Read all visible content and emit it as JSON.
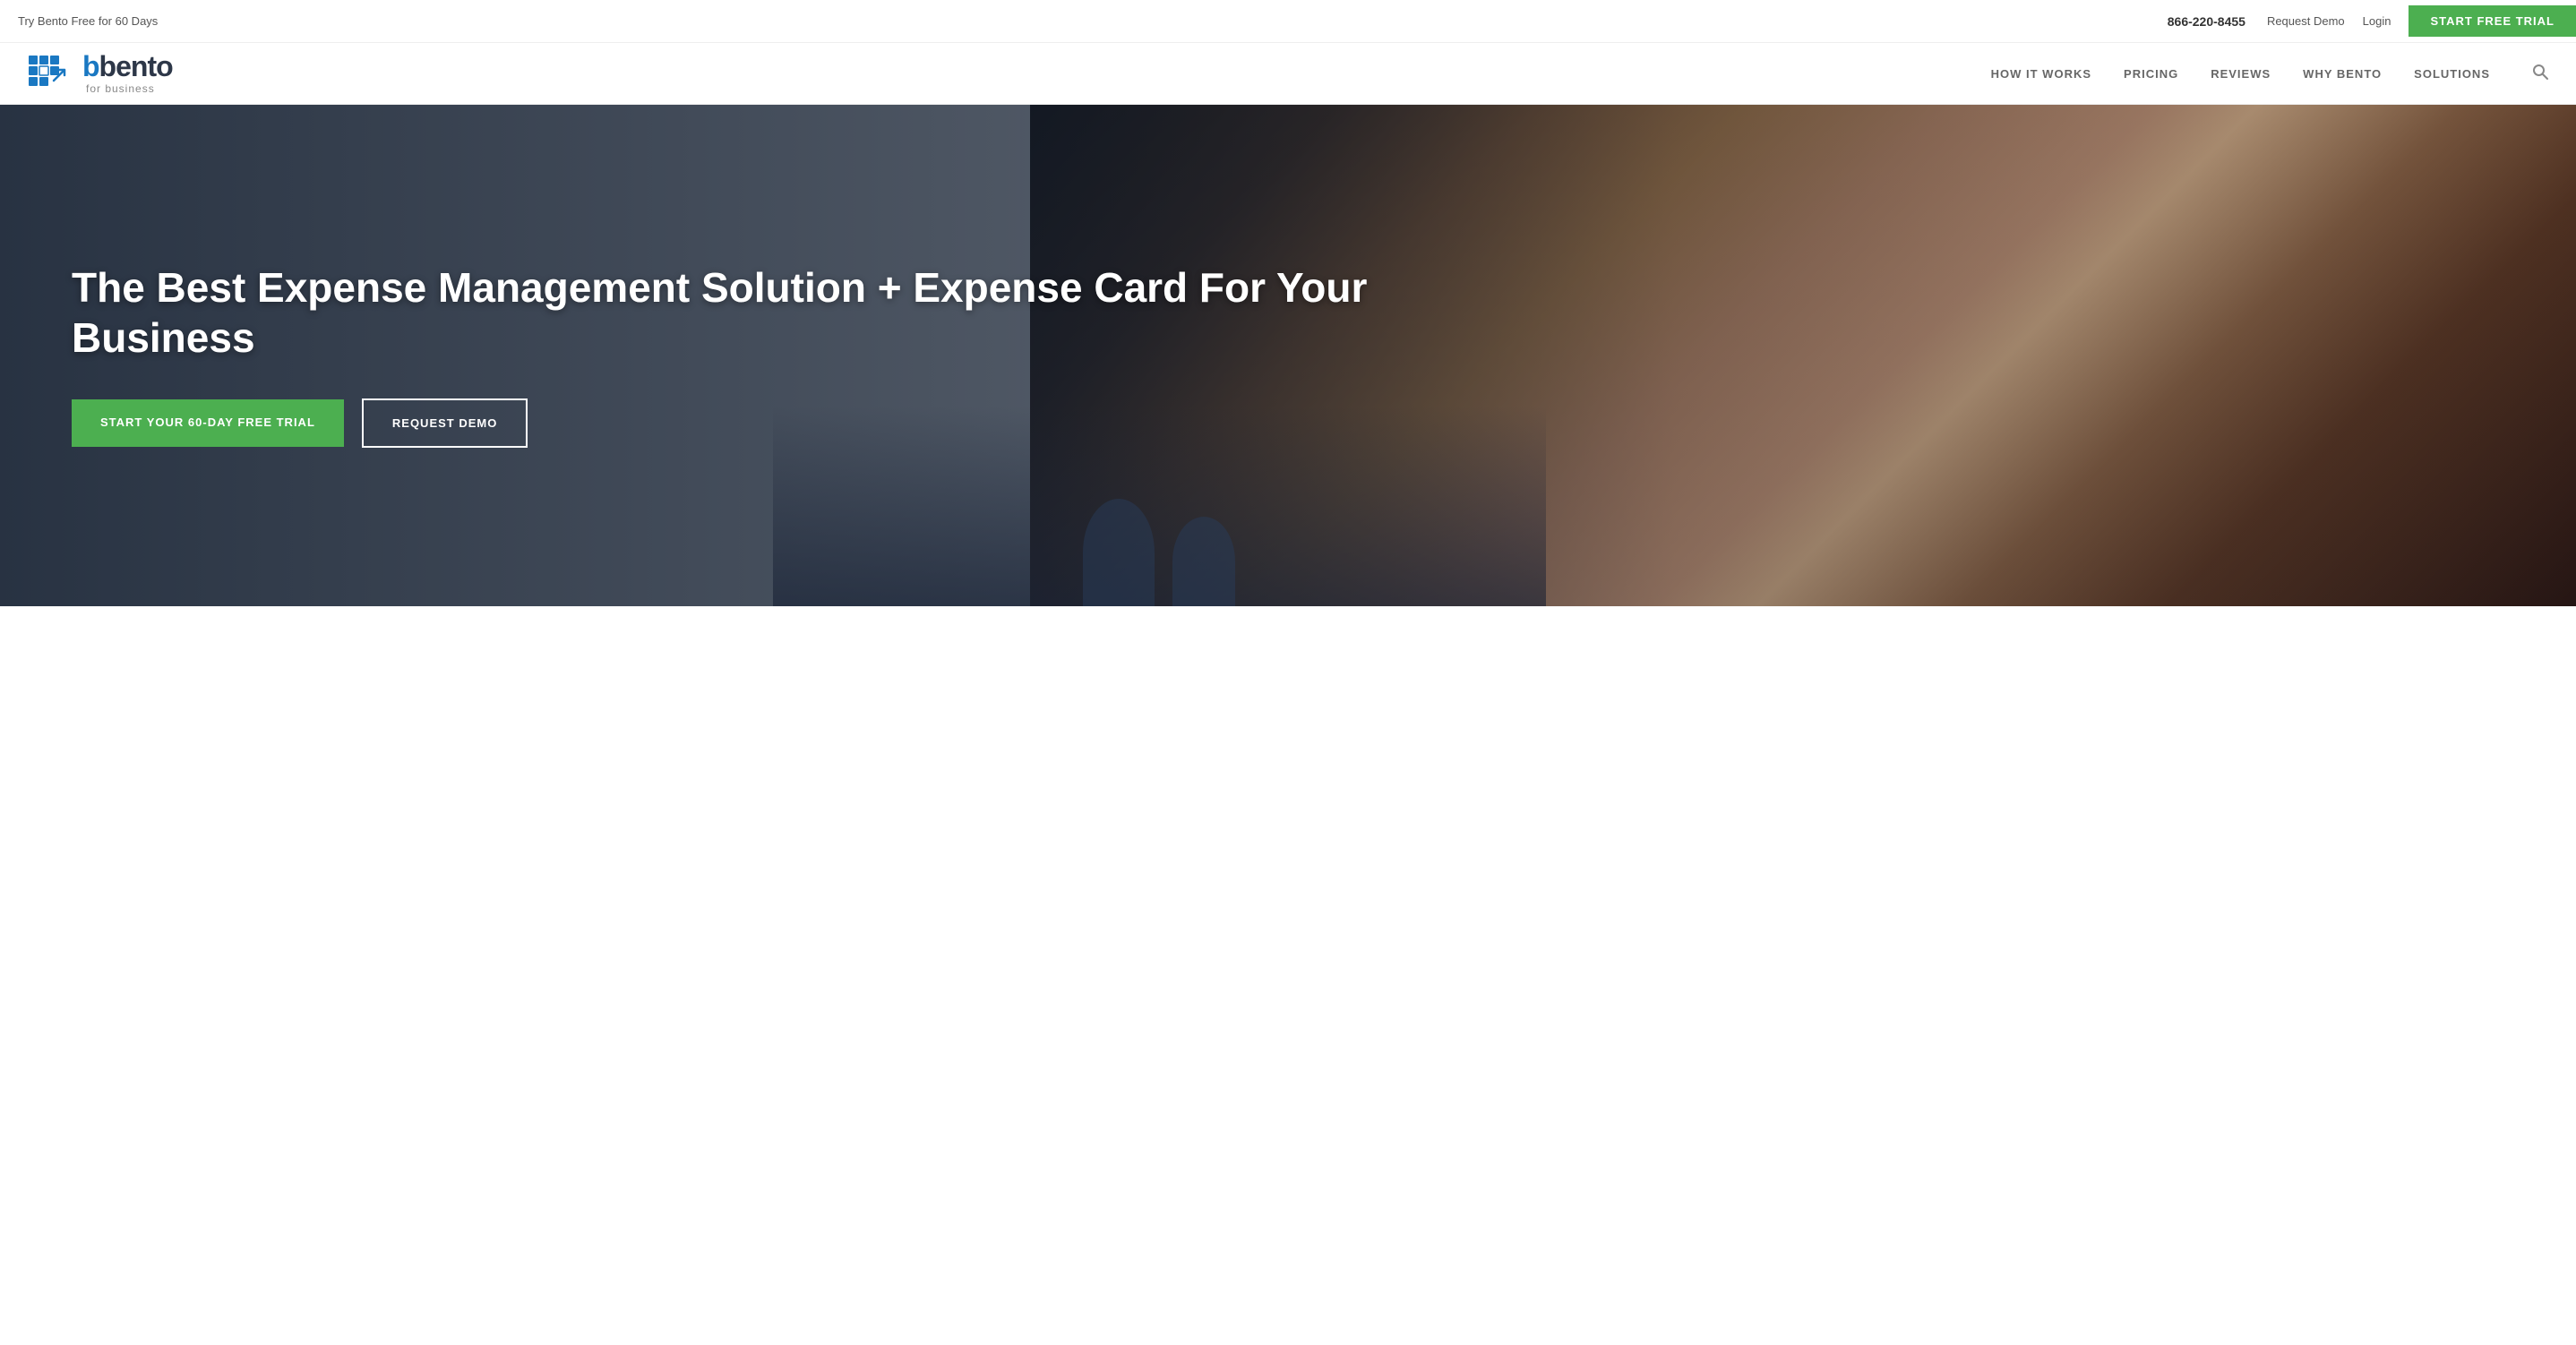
{
  "topbar": {
    "trial_text": "Try Bento Free for 60 Days",
    "phone": "866-220-8455",
    "request_demo": "Request Demo",
    "login": "Login",
    "start_trial": "START FREE TRIAL"
  },
  "navbar": {
    "logo_bento": "bento",
    "logo_sub": "for business",
    "nav_items": [
      {
        "label": "HOW IT WORKS",
        "id": "how-it-works"
      },
      {
        "label": "PRICING",
        "id": "pricing"
      },
      {
        "label": "REVIEWS",
        "id": "reviews"
      },
      {
        "label": "WHY BENTO",
        "id": "why-bento"
      },
      {
        "label": "SOLUTIONS",
        "id": "solutions"
      }
    ]
  },
  "hero": {
    "title": "The Best Expense Management Solution + Expense Card For Your Business",
    "cta_primary": "START YOUR 60-DAY FREE TRIAL",
    "cta_secondary": "REQUEST DEMO"
  },
  "colors": {
    "green": "#4caf50",
    "blue": "#1a78c2",
    "dark_navy": "#0d1f35",
    "white": "#ffffff"
  }
}
